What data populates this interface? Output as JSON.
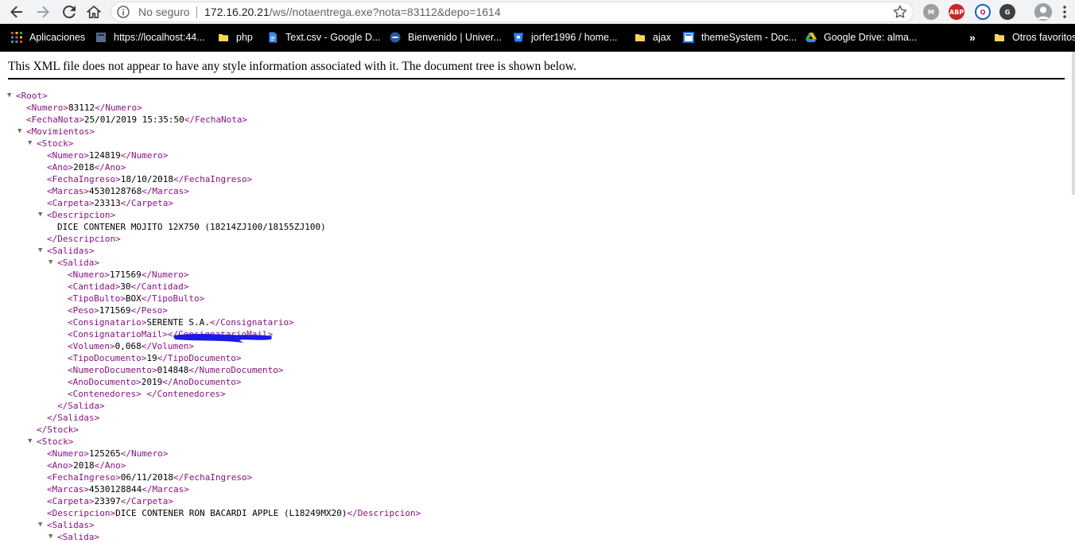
{
  "browser": {
    "security_label": "No seguro",
    "url_host": "172.16.20.21",
    "url_path": "/ws//notaentrega.exe?nota=83112&depo=1614",
    "extensions": [
      "M",
      "ABP",
      "Q",
      "G"
    ],
    "bookmarks": [
      {
        "label": "Aplicaciones",
        "icon": "apps-grid-icon"
      },
      {
        "label": "https://localhost:44...",
        "icon": "page-icon"
      },
      {
        "label": "php",
        "icon": "folder-icon"
      },
      {
        "label": "Text.csv - Google D...",
        "icon": "google-docs-icon"
      },
      {
        "label": "Bienvenido | Univer...",
        "icon": "site-icon"
      },
      {
        "label": "jorfer1996 / home...",
        "icon": "bitbucket-icon"
      },
      {
        "label": "ajax",
        "icon": "folder-icon"
      },
      {
        "label": "themeSystem - Doc...",
        "icon": "page-icon"
      },
      {
        "label": "Google Drive: alma...",
        "icon": "google-drive-icon"
      },
      {
        "label": "»",
        "icon": ""
      },
      {
        "label": "Otros favoritos",
        "icon": "folder-icon"
      }
    ]
  },
  "xml_notice": "This XML file does not appear to have any style information associated with it. The document tree is shown below.",
  "xml_lines": [
    {
      "t": "<Root>"
    },
    {
      "t": "<Numero>",
      "v": "83112",
      "c": "</Numero>"
    },
    {
      "t": "<FechaNota>",
      "v": "25/01/2019 15:35:50",
      "c": "</FechaNota>"
    },
    {
      "t": "<Movimientos>"
    },
    {
      "t": "<Stock>"
    },
    {
      "t": "<Numero>",
      "v": "124819",
      "c": "</Numero>"
    },
    {
      "t": "<Ano>",
      "v": "2018",
      "c": "</Ano>"
    },
    {
      "t": "<FechaIngreso>",
      "v": "18/10/2018",
      "c": "</FechaIngreso>"
    },
    {
      "t": "<Marcas>",
      "v": "4530128768",
      "c": "</Marcas>"
    },
    {
      "t": "<Carpeta>",
      "v": "23313",
      "c": "</Carpeta>"
    },
    {
      "t": "<Descripcion>"
    },
    {
      "v": "DICE CONTENER MOJITO 12X750 (18214ZJ100/18155ZJ100)"
    },
    {
      "t": "</Descripcion>"
    },
    {
      "t": "<Salidas>"
    },
    {
      "t": "<Salida>"
    },
    {
      "t": "<Numero>",
      "v": "171569",
      "c": "</Numero>"
    },
    {
      "t": "<Cantidad>",
      "v": "30",
      "c": "</Cantidad>"
    },
    {
      "t": "<TipoBulto>",
      "v": "BOX",
      "c": "</TipoBulto>"
    },
    {
      "t": "<Peso>",
      "v": "171569",
      "c": "</Peso>"
    },
    {
      "t": "<Consignatario>",
      "v": "SERENTE S.A.",
      "c": "</Consignatario>"
    },
    {
      "t": "<ConsignatarioMail>",
      "v": "",
      "c": "</ConsignatarioMail>"
    },
    {
      "t": "<Volumen>",
      "v": "0,068",
      "c": "</Volumen>"
    },
    {
      "t": "<TipoDocumento>",
      "v": "19",
      "c": "</TipoDocumento>"
    },
    {
      "t": "<NumeroDocumento>",
      "v": "014848",
      "c": "</NumeroDocumento>"
    },
    {
      "t": "<AnoDocumento>",
      "v": "2019",
      "c": "</AnoDocumento>"
    },
    {
      "t": "<Contenedores>",
      "v": " ",
      "c": "</Contenedores>"
    },
    {
      "t": "</Salida>"
    },
    {
      "t": "</Salidas>"
    },
    {
      "t": "</Stock>"
    },
    {
      "t": "<Stock>"
    },
    {
      "t": "<Numero>",
      "v": "125265",
      "c": "</Numero>"
    },
    {
      "t": "<Ano>",
      "v": "2018",
      "c": "</Ano>"
    },
    {
      "t": "<FechaIngreso>",
      "v": "06/11/2018",
      "c": "</FechaIngreso>"
    },
    {
      "t": "<Marcas>",
      "v": "4530128844",
      "c": "</Marcas>"
    },
    {
      "t": "<Carpeta>",
      "v": "23397",
      "c": "</Carpeta>"
    },
    {
      "t": "<Descripcion>",
      "v": "DICE CONTENER RON BACARDI APPLE (L18249MX20)",
      "c": "</Descripcion>"
    },
    {
      "t": "<Salidas>"
    },
    {
      "t": "<Salida>"
    }
  ]
}
